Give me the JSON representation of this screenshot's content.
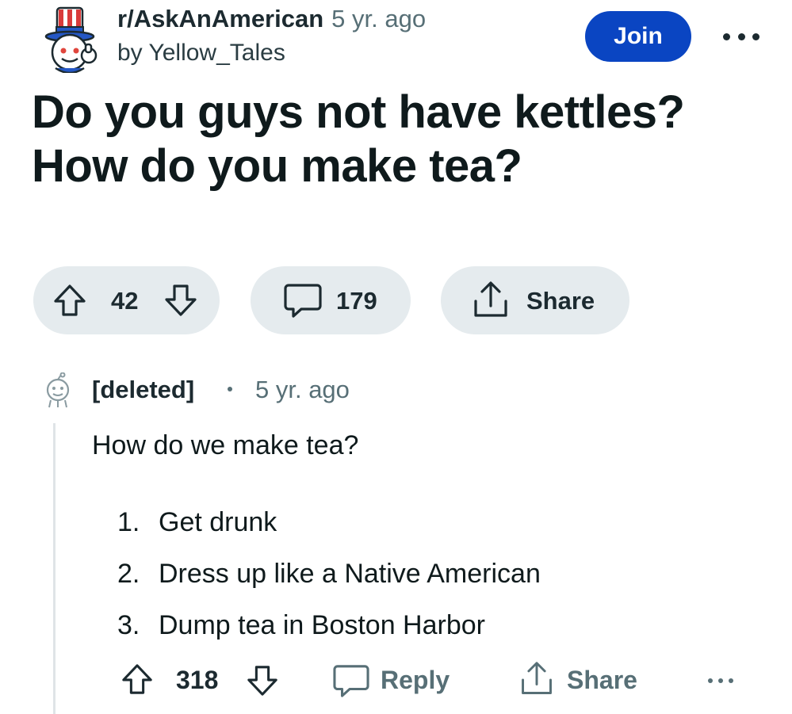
{
  "post": {
    "subreddit": "r/AskAnAmerican",
    "time": "5 yr. ago",
    "author": "by Yellow_Tales",
    "join_label": "Join",
    "title_line1": "Do you guys not have kettles?",
    "title_line2": "How do you make tea?",
    "votes": "42",
    "comments": "179",
    "share_label": "Share"
  },
  "comment": {
    "author": "[deleted]",
    "time": "5 yr. ago",
    "body": "How do we make tea?",
    "list": [
      {
        "num": "1.",
        "text": "Get drunk"
      },
      {
        "num": "2.",
        "text": "Dress up like a Native American"
      },
      {
        "num": "3.",
        "text": "Dump tea in Boston Harbor"
      }
    ],
    "score": "318",
    "reply_label": "Reply",
    "share_label": "Share"
  },
  "icons": {
    "subreddit_avatar": "uncle-sam-snoo-icon",
    "upvote": "arrow-up-icon",
    "downvote": "arrow-down-icon",
    "comment": "speech-bubble-icon",
    "share": "share-upload-icon",
    "more": "ellipsis-icon",
    "deleted_avatar": "ghost-snoo-icon"
  },
  "colors": {
    "join_button": "#0a45c2",
    "pill_background": "#e5ebee",
    "muted_text": "#576f76"
  }
}
